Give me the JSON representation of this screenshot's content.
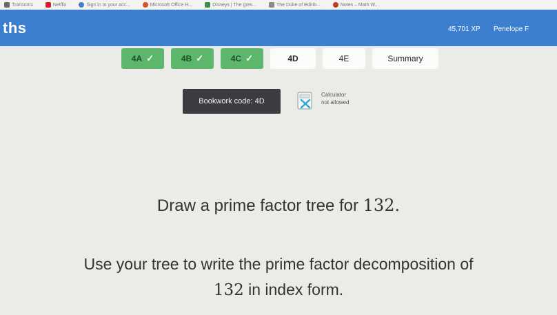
{
  "bookmarks": [
    {
      "label": "Transoms",
      "color": "#6b6b6b"
    },
    {
      "label": "Netflix",
      "color": "#d11f2a"
    },
    {
      "label": "Sign in to your acc...",
      "color": "#4a7fd0"
    },
    {
      "label": "Microsoft Office H...",
      "color": "#d9532b"
    },
    {
      "label": "Disneys | The gres...",
      "color": "#3a8d4a"
    },
    {
      "label": "The Duke of Edinb...",
      "color": "#8a8a8a"
    },
    {
      "label": "Notes – Math W...",
      "color": "#c0392b"
    }
  ],
  "header": {
    "brand": "ths",
    "xp": "45,701 XP",
    "user": "Penelope F"
  },
  "tabs": [
    {
      "label": "4A",
      "status": "done"
    },
    {
      "label": "4B",
      "status": "done"
    },
    {
      "label": "4C",
      "status": "done"
    },
    {
      "label": "4D",
      "status": "current"
    },
    {
      "label": "4E",
      "status": "pending"
    },
    {
      "label": "Summary",
      "status": "pending"
    }
  ],
  "check_glyph": "✓",
  "bookwork": "Bookwork code: 4D",
  "calculator": {
    "line1": "Calculator",
    "line2": "not allowed"
  },
  "question": {
    "line1_text": "Draw a prime factor tree for ",
    "line1_num": "132.",
    "line2": "Use your tree to write the prime factor decomposition of",
    "line3_num": "132",
    "line3_text": " in index form."
  },
  "colors": {
    "header_blue": "#3d7fcf",
    "done_green": "#5db66b",
    "bookwork_dark": "#3b3c40",
    "calc_cross": "#2aa7d6"
  }
}
